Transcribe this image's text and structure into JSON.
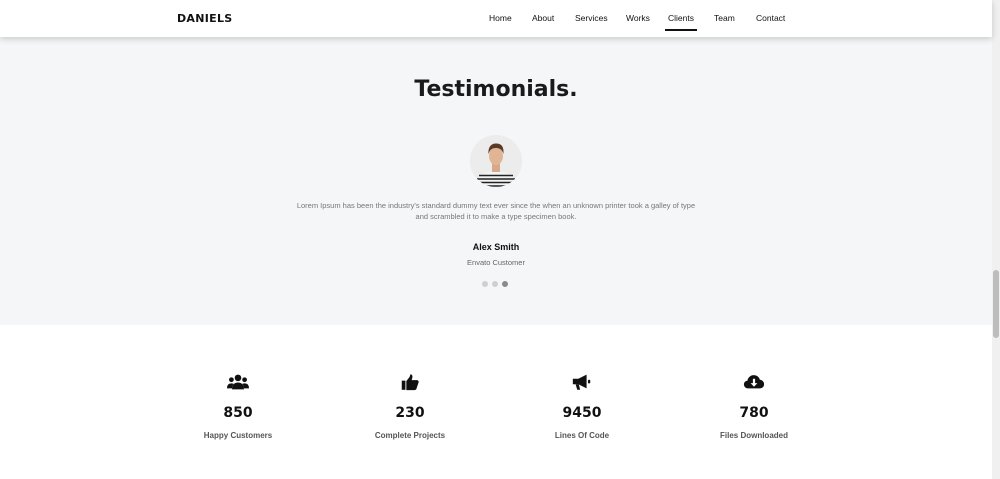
{
  "nav": {
    "brand": "DANIELS",
    "items": [
      {
        "label": "Home"
      },
      {
        "label": "About"
      },
      {
        "label": "Services"
      },
      {
        "label": "Works"
      },
      {
        "label": "Clients"
      },
      {
        "label": "Team"
      },
      {
        "label": "Contact"
      }
    ],
    "active": "Clients"
  },
  "testimonials": {
    "title": "Testimonials.",
    "quote_line1": "Lorem Ipsum has been the industry's standard dummy text ever since the when an unknown printer took a galley of type",
    "quote_line2": "and scrambled it to make a type specimen book.",
    "name": "Alex Smith",
    "role": "Envato Customer",
    "slides_total": 3,
    "active_slide": 3
  },
  "stats": [
    {
      "icon": "users-icon",
      "value": "850",
      "label": "Happy Customers"
    },
    {
      "icon": "thumbs-up-icon",
      "value": "230",
      "label": "Complete Projects"
    },
    {
      "icon": "megaphone-icon",
      "value": "9450",
      "label": "Lines Of Code"
    },
    {
      "icon": "cloud-download-icon",
      "value": "780",
      "label": "Files Downloaded"
    }
  ]
}
